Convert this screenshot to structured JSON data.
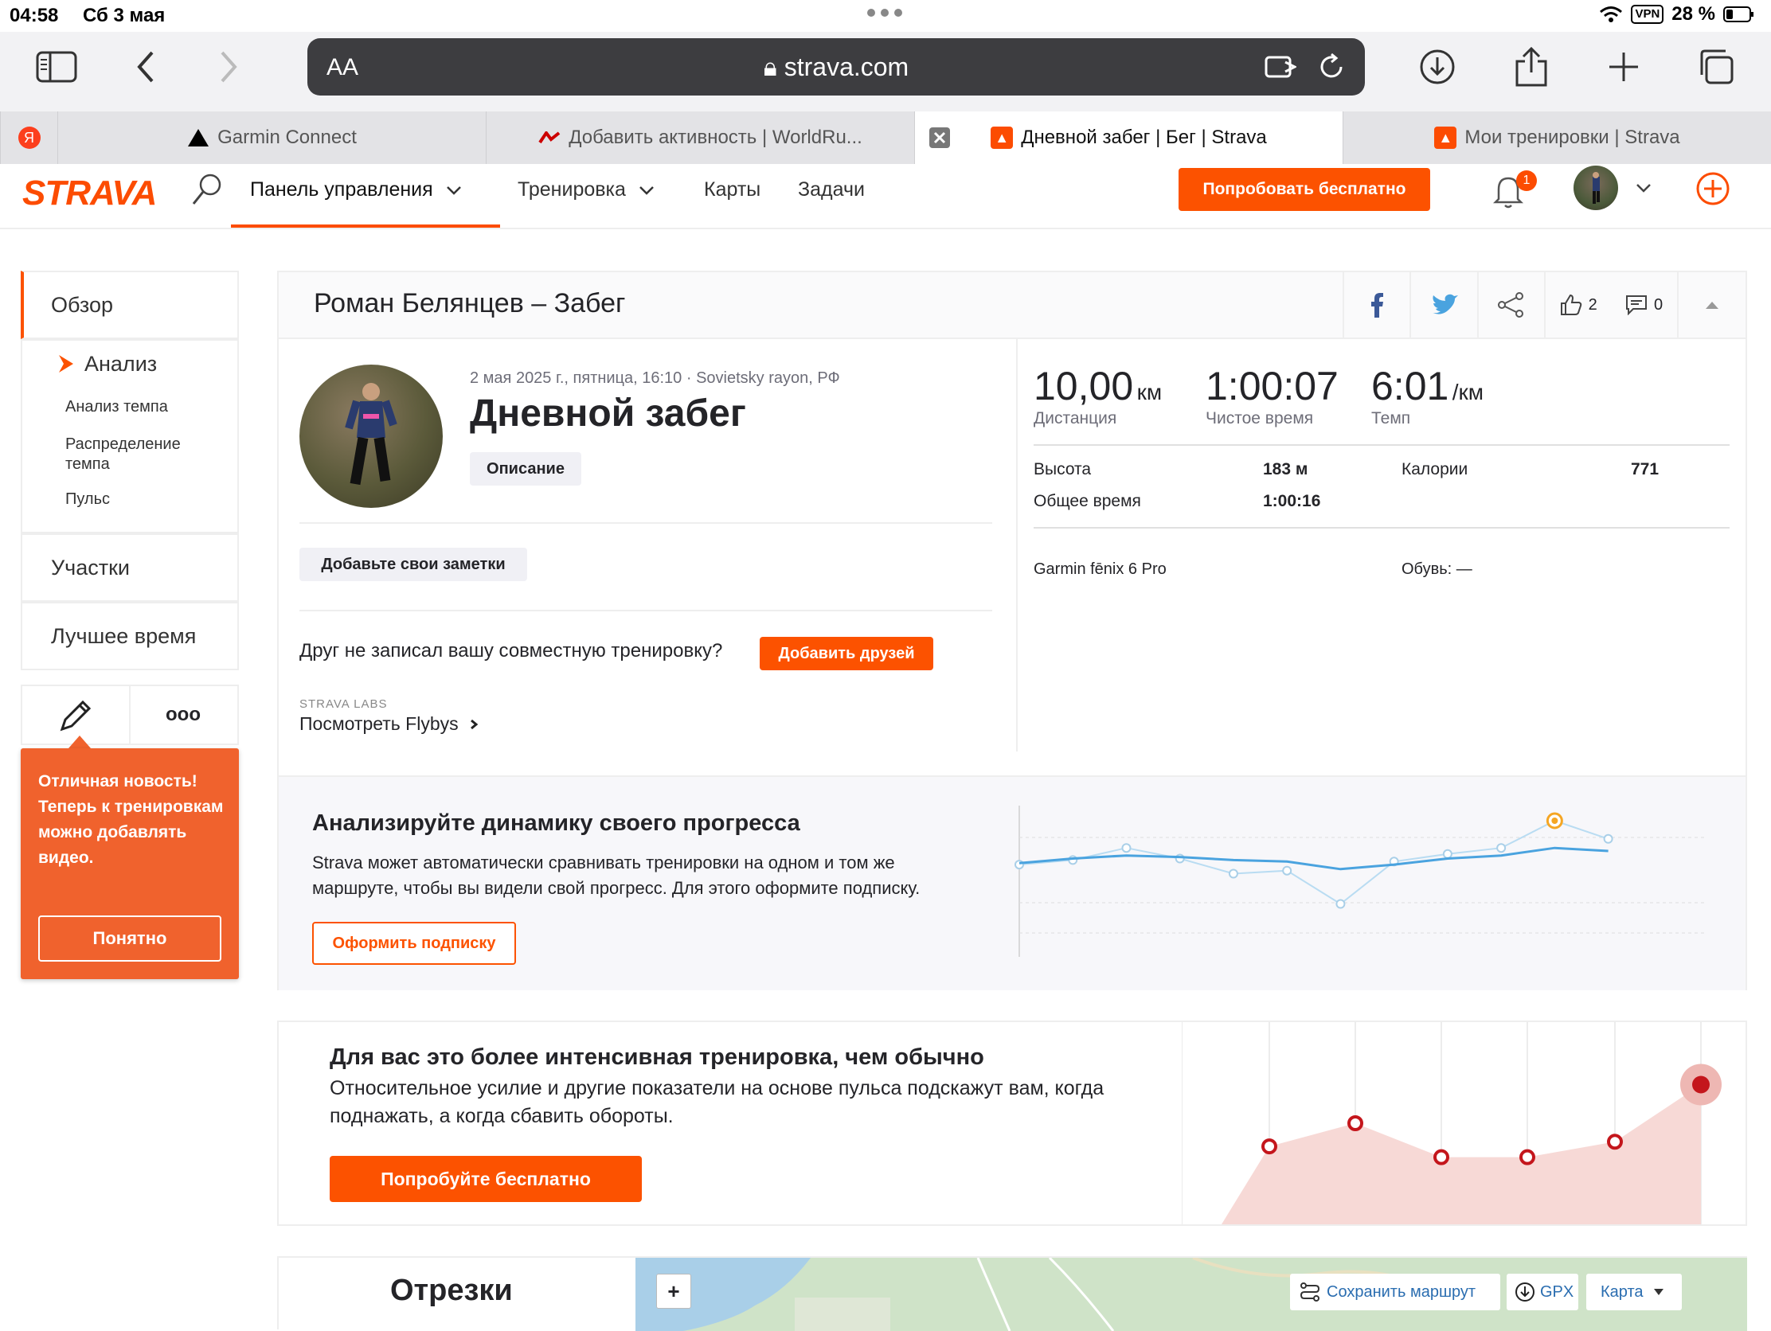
{
  "status_bar": {
    "time": "04:58",
    "date": "Сб 3 мая",
    "vpn": "VPN",
    "battery": "28 %"
  },
  "browser": {
    "aa_label": "AA",
    "url": "strava.com",
    "tabs": [
      {
        "label": "Я",
        "icon": "yandex-icon"
      },
      {
        "label": "Garmin Connect",
        "icon": "garmin-icon"
      },
      {
        "label": "Добавить активность | WorldRu...",
        "icon": "worldrun-icon"
      },
      {
        "label": "Дневной забег | Бег | Strava",
        "icon": "strava-icon",
        "active": true
      },
      {
        "label": "Мои тренировки | Strava",
        "icon": "strava-icon"
      }
    ]
  },
  "header": {
    "logo": "STRAVA",
    "nav": {
      "dashboard": "Панель управления",
      "training": "Тренировка",
      "maps": "Карты",
      "challenges": "Задачи"
    },
    "trial_button": "Попробовать бесплатно",
    "notifications_count": "1"
  },
  "sidebar": {
    "overview": "Обзор",
    "analysis": "Анализ",
    "sub_items": [
      "Анализ темпа",
      "Распределение темпа",
      "Пульс"
    ],
    "segments": "Участки",
    "best_efforts": "Лучшее время",
    "more_label": "ooo"
  },
  "tooltip": {
    "text": "Отличная новость! Теперь к тренировкам можно добавлять видео.",
    "button": "Понятно"
  },
  "activity": {
    "header_title": "Роман Белянцев – Забег",
    "kudos_count": "2",
    "comments_count": "0",
    "meta": "2 мая 2025 г., пятница, 16:10 · Sovietsky rayon, РФ",
    "title": "Дневной забег",
    "description_button": "Описание",
    "notes_button": "Добавьте свои заметки",
    "friend_prompt": "Друг не записал вашу совместную тренировку?",
    "add_friends_button": "Добавить друзей",
    "labs_label": "STRAVA LABS",
    "flybys_link": "Посмотреть Flybys",
    "stats": {
      "distance": {
        "value": "10,00",
        "unit": "км",
        "label": "Дистанция"
      },
      "moving_time": {
        "value": "1:00:07",
        "label": "Чистое время"
      },
      "pace": {
        "value": "6:01",
        "unit": "/км",
        "label": "Темп"
      }
    },
    "details": {
      "elevation_label": "Высота",
      "elevation_value": "183 м",
      "calories_label": "Калории",
      "calories_value": "771",
      "elapsed_label": "Общее время",
      "elapsed_value": "1:00:16"
    },
    "device": "Garmin fēnix 6 Pro",
    "shoes": "Обувь: —"
  },
  "progress_promo": {
    "title": "Анализируйте динамику своего прогресса",
    "text": "Strava может автоматически сравнивать тренировки на одном и том же маршруте, чтобы вы видели свой прогресс. Для этого оформите подписку.",
    "button": "Оформить подписку",
    "trend_line": [
      0.62,
      0.65,
      0.67,
      0.66,
      0.64,
      0.63,
      0.58,
      0.61,
      0.65,
      0.67,
      0.72,
      0.7
    ],
    "raw_line": [
      0.61,
      0.64,
      0.72,
      0.65,
      0.55,
      0.57,
      0.35,
      0.63,
      0.68,
      0.72,
      0.9,
      0.78
    ]
  },
  "effort_promo": {
    "title": "Для вас это более интенсивная тренировка, чем обычно",
    "text": "Относительное усилие и другие показатели на основе пульса подскажут вам, когда поднажать, а когда сбавить обороты.",
    "button": "Попробуйте бесплатно",
    "points": [
      0.35,
      0.5,
      0.28,
      0.28,
      0.38,
      0.75
    ]
  },
  "segments": {
    "title": "Отрезки",
    "zoom_in": "+",
    "save_route": "Сохранить маршрут",
    "gpx": "GPX",
    "map_type": "Карта"
  },
  "colors": {
    "accent": "#fc5200",
    "chart_blue": "#4aa3df",
    "effort_red": "#c4161c"
  }
}
